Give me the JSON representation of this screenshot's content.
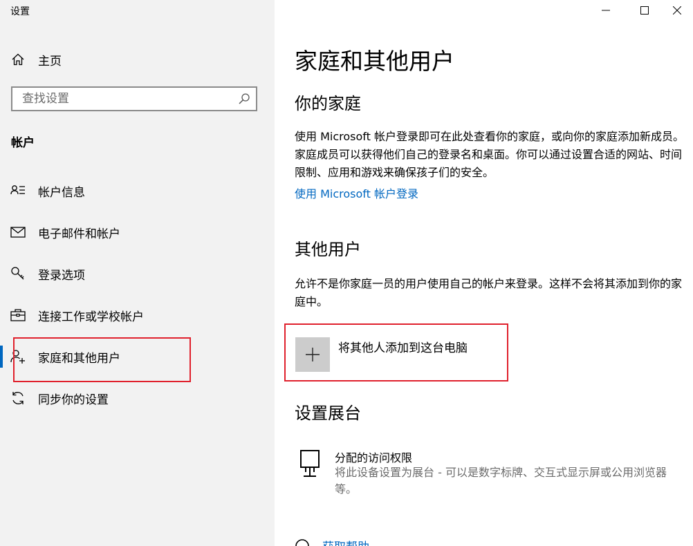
{
  "window": {
    "title": "设置"
  },
  "sidebar": {
    "home_label": "主页",
    "search_placeholder": "查找设置",
    "section_label": "帐户",
    "items": [
      {
        "label": "帐户信息",
        "icon": "account-info-icon"
      },
      {
        "label": "电子邮件和帐户",
        "icon": "mail-icon"
      },
      {
        "label": "登录选项",
        "icon": "key-icon"
      },
      {
        "label": "连接工作或学校帐户",
        "icon": "briefcase-icon"
      },
      {
        "label": "家庭和其他用户",
        "icon": "add-person-icon",
        "selected": true
      },
      {
        "label": "同步你的设置",
        "icon": "sync-icon"
      }
    ]
  },
  "main": {
    "page_title": "家庭和其他用户",
    "family": {
      "heading": "你的家庭",
      "description": "使用 Microsoft 帐户登录即可在此处查看你的家庭，或向你的家庭添加新成员。家庭成员可以获得他们自己的登录名和桌面。你可以通过设置合适的网站、时间限制、应用和游戏来确保孩子们的安全。",
      "link": "使用 Microsoft 帐户登录"
    },
    "other_users": {
      "heading": "其他用户",
      "description": "允许不是你家庭一员的用户使用自己的帐户来登录。这样不会将其添加到你的家庭中。",
      "add_button_label": "将其他人添加到这台电脑"
    },
    "kiosk": {
      "heading": "设置展台",
      "item_title": "分配的访问权限",
      "item_description": "将此设备设置为展台 - 可以是数字标牌、交互式显示屏或公用浏览器等。"
    },
    "help": {
      "link": "获取帮助"
    }
  },
  "colors": {
    "accent": "#0067c0",
    "highlight": "#e0202c",
    "sidebar_bg": "#f2f2f2",
    "tile_bg": "#cccccc"
  }
}
